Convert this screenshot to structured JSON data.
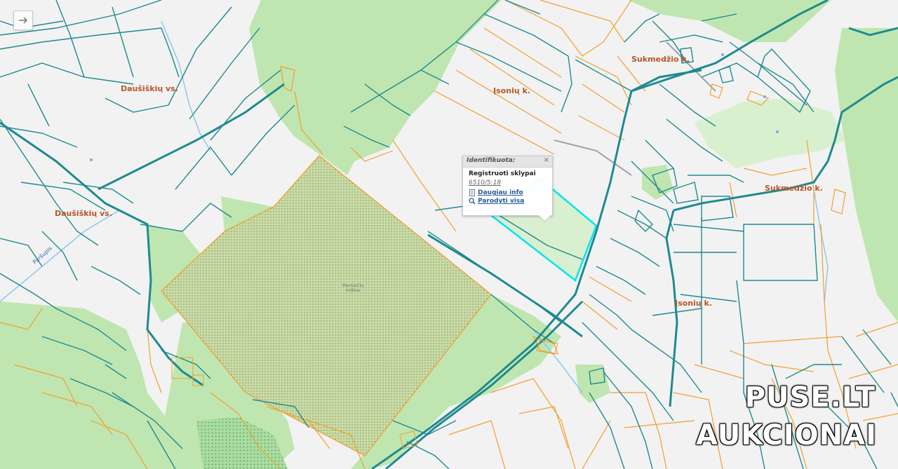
{
  "map": {
    "labels": {
      "dausiskiu_1": "Daušiškių vs.",
      "dausiskiu_2": "Daušiškių vs.",
      "isoniu_1": "Įsonių k.",
      "isoniu_2": "Įsonių k.",
      "sukmedzio_1": "Sukmedžio k.",
      "sukmedzio_2": "Sukmedžio k.",
      "parsupis": "Paršupis",
      "forest_line1": "Mantarčių",
      "forest_line2": "miškas"
    },
    "colors": {
      "background": "#f2f2f2",
      "forest": "#bfe6b0",
      "forest_light": "#d9f0cf",
      "parcel_teal": "#1f8a8f",
      "parcel_orange": "#f0a030",
      "highlight": "#00e5ee",
      "label": "#b5562a",
      "river": "#8fc8ef"
    }
  },
  "nav": {
    "arrow_icon": "arrow-right-icon"
  },
  "popup": {
    "header": "Identifikuota:",
    "close": "×",
    "title": "Registruoti sklypai",
    "parcel_id": "6510/5:18",
    "link_more": "Daugiau info",
    "link_show": "Parodyti visa"
  },
  "watermark": {
    "line1": "PUSE.LT",
    "line2": "AUKCIONAI"
  }
}
